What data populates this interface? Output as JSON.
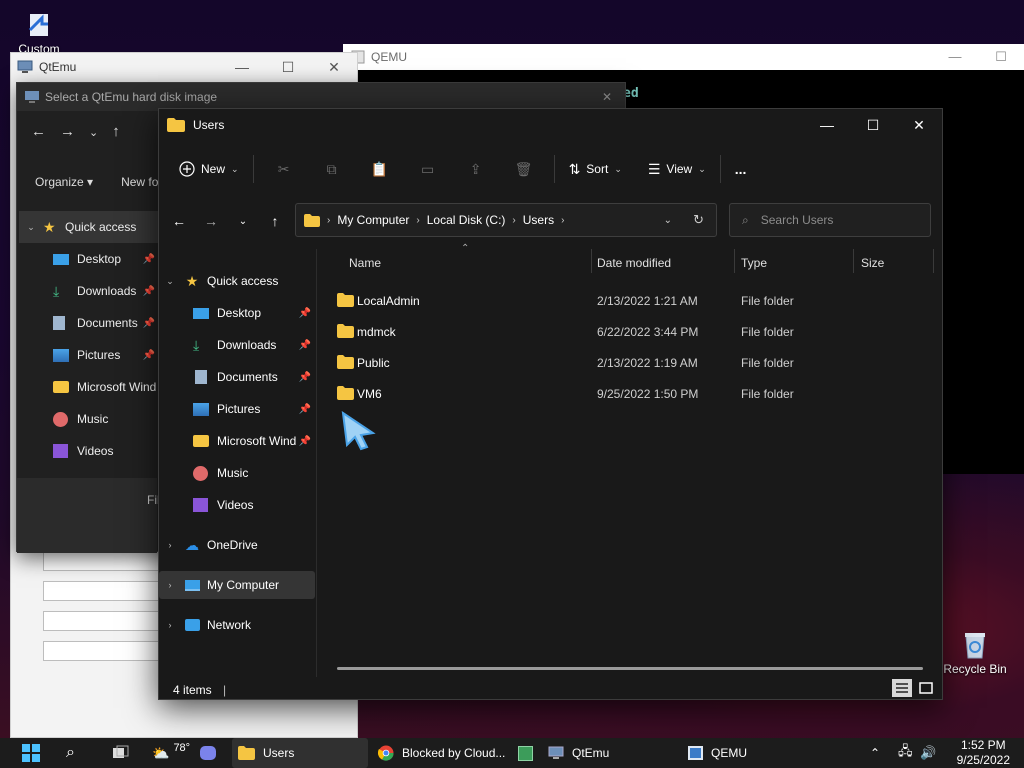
{
  "desktop": {
    "icons": [
      {
        "label": "Custom",
        "name": "custom-shortcut"
      },
      {
        "label": "Recycle Bin",
        "name": "recycle-bin"
      }
    ]
  },
  "qemu_window": {
    "title": "QEMU",
    "console_text": "ed"
  },
  "qtemu_window": {
    "title": "QtEmu"
  },
  "file_dialog": {
    "title": "Select a QtEmu hard disk image",
    "toolbar": {
      "organize": "Organize",
      "new_folder": "New fo"
    },
    "sidebar": [
      {
        "label": "Quick access",
        "icon": "star-icon",
        "pinned": false
      },
      {
        "label": "Desktop",
        "icon": "desktop-icon",
        "pinned": true
      },
      {
        "label": "Downloads",
        "icon": "download-icon",
        "pinned": true
      },
      {
        "label": "Documents",
        "icon": "document-icon",
        "pinned": true
      },
      {
        "label": "Pictures",
        "icon": "pictures-icon",
        "pinned": true
      },
      {
        "label": "Microsoft Wind",
        "icon": "folder-icon",
        "pinned": false
      },
      {
        "label": "Music",
        "icon": "music-icon",
        "pinned": false
      },
      {
        "label": "Videos",
        "icon": "videos-icon",
        "pinned": false
      }
    ],
    "filename_label": "Fil"
  },
  "explorer": {
    "title": "Users",
    "commands": {
      "new": "New",
      "sort": "Sort",
      "view": "View",
      "more": "..."
    },
    "address": {
      "crumbs": [
        "My Computer",
        "Local Disk (C:)",
        "Users"
      ]
    },
    "search_placeholder": "Search Users",
    "nav": {
      "quick_access": "Quick access",
      "items": [
        {
          "label": "Desktop",
          "icon": "desktop-icon",
          "pinned": true
        },
        {
          "label": "Downloads",
          "icon": "download-icon",
          "pinned": true
        },
        {
          "label": "Documents",
          "icon": "document-icon",
          "pinned": true
        },
        {
          "label": "Pictures",
          "icon": "pictures-icon",
          "pinned": true
        },
        {
          "label": "Microsoft Wind",
          "icon": "folder-icon",
          "pinned": true
        },
        {
          "label": "Music",
          "icon": "music-icon",
          "pinned": false
        },
        {
          "label": "Videos",
          "icon": "videos-icon",
          "pinned": false
        }
      ],
      "onedrive": "OneDrive",
      "my_computer": "My Computer",
      "network": "Network"
    },
    "columns": {
      "name": "Name",
      "date": "Date modified",
      "type": "Type",
      "size": "Size"
    },
    "files": [
      {
        "name": "LocalAdmin",
        "date": "2/13/2022 1:21 AM",
        "type": "File folder"
      },
      {
        "name": "mdmck",
        "date": "6/22/2022 3:44 PM",
        "type": "File folder"
      },
      {
        "name": "Public",
        "date": "2/13/2022 1:19 AM",
        "type": "File folder"
      },
      {
        "name": "VM6",
        "date": "9/25/2022 1:50 PM",
        "type": "File folder"
      }
    ],
    "status": "4 items"
  },
  "taskbar": {
    "weather": "78°",
    "apps": [
      {
        "label": "Users",
        "icon": "folder-icon",
        "active": true
      },
      {
        "label": "Blocked by Cloud...",
        "icon": "chrome-icon",
        "active": false
      },
      {
        "label": "QtEmu",
        "icon": "qtemu-icon",
        "active": false
      },
      {
        "label": "QEMU",
        "icon": "qemu-icon",
        "active": false
      }
    ],
    "time": "1:52 PM",
    "date": "9/25/2022"
  },
  "colors": {
    "folder": "#f5c542",
    "accent": "#4cc2ff",
    "explorer_bg": "#191919"
  }
}
